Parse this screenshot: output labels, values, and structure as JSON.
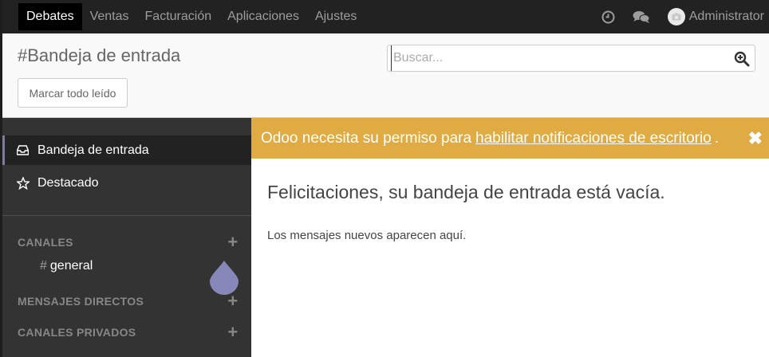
{
  "navbar": {
    "menu": [
      "Debates",
      "Ventas",
      "Facturación",
      "Aplicaciones",
      "Ajustes"
    ],
    "active_index": 0,
    "user_name": "Administrator",
    "icons": [
      "clock-icon",
      "chat-icon",
      "avatar"
    ]
  },
  "control_panel": {
    "title": "#Bandeja de entrada",
    "mark_all_read": "Marcar todo leído",
    "search_placeholder": "Buscar..."
  },
  "sidebar": {
    "items": [
      {
        "label": "Bandeja de entrada",
        "icon": "inbox-icon",
        "active": true
      },
      {
        "label": "Destacado",
        "icon": "star-icon",
        "active": false
      }
    ],
    "sections": [
      {
        "title": "CANALES",
        "channels": [
          "general"
        ]
      },
      {
        "title": "MENSAJES DIRECTOS"
      },
      {
        "title": "CANALES PRIVADOS"
      }
    ]
  },
  "banner": {
    "text": "Odoo necesita su permiso para",
    "link": "habilitar notificaciones de escritorio",
    "end": ".",
    "color": "#e1ab43"
  },
  "main": {
    "empty_title": "Felicitaciones, su bandeja de entrada está vacía.",
    "empty_sub": "Los mensajes nuevos aparecen aquí."
  },
  "colors": {
    "navbar_bg": "#222222",
    "sidebar_bg": "#333333",
    "accent": "#7c7bad"
  }
}
